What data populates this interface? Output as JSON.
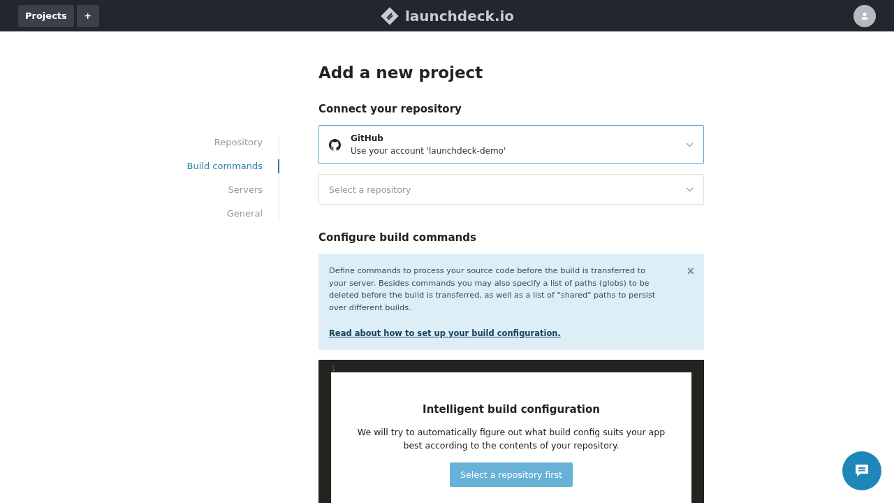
{
  "topbar": {
    "projects_button": "Projects",
    "add_button": "+",
    "brand": "launchdeck.io"
  },
  "page_title": "Add a new project",
  "steps": [
    {
      "label": "Repository",
      "selected": false
    },
    {
      "label": "Build commands",
      "selected": true
    },
    {
      "label": "Servers",
      "selected": false
    },
    {
      "label": "General",
      "selected": false
    }
  ],
  "repository_section": {
    "heading": "Connect your repository",
    "provider": {
      "name": "GitHub",
      "account": "Use your account 'launchdeck-demo'"
    },
    "repository_select": {
      "placeholder": "Select a repository"
    }
  },
  "build_section": {
    "heading": "Configure build commands",
    "notice": {
      "text": "Define commands to process your source code before the build is transferred to your server. Besides commands you may also specify a list of paths (globs) to be deleted before the build is transferred, as well as a list of \"shared\" paths to persist over different builds.",
      "link": "Read about how to set up your build configuration.",
      "close": "×"
    },
    "editor": {
      "line_number": "1",
      "overlay": {
        "title": "Intelligent build configuration",
        "text": "We will try to automatically figure out what build config suits your app best according to the contents of your repository.",
        "button": "Select a repository first"
      }
    }
  }
}
